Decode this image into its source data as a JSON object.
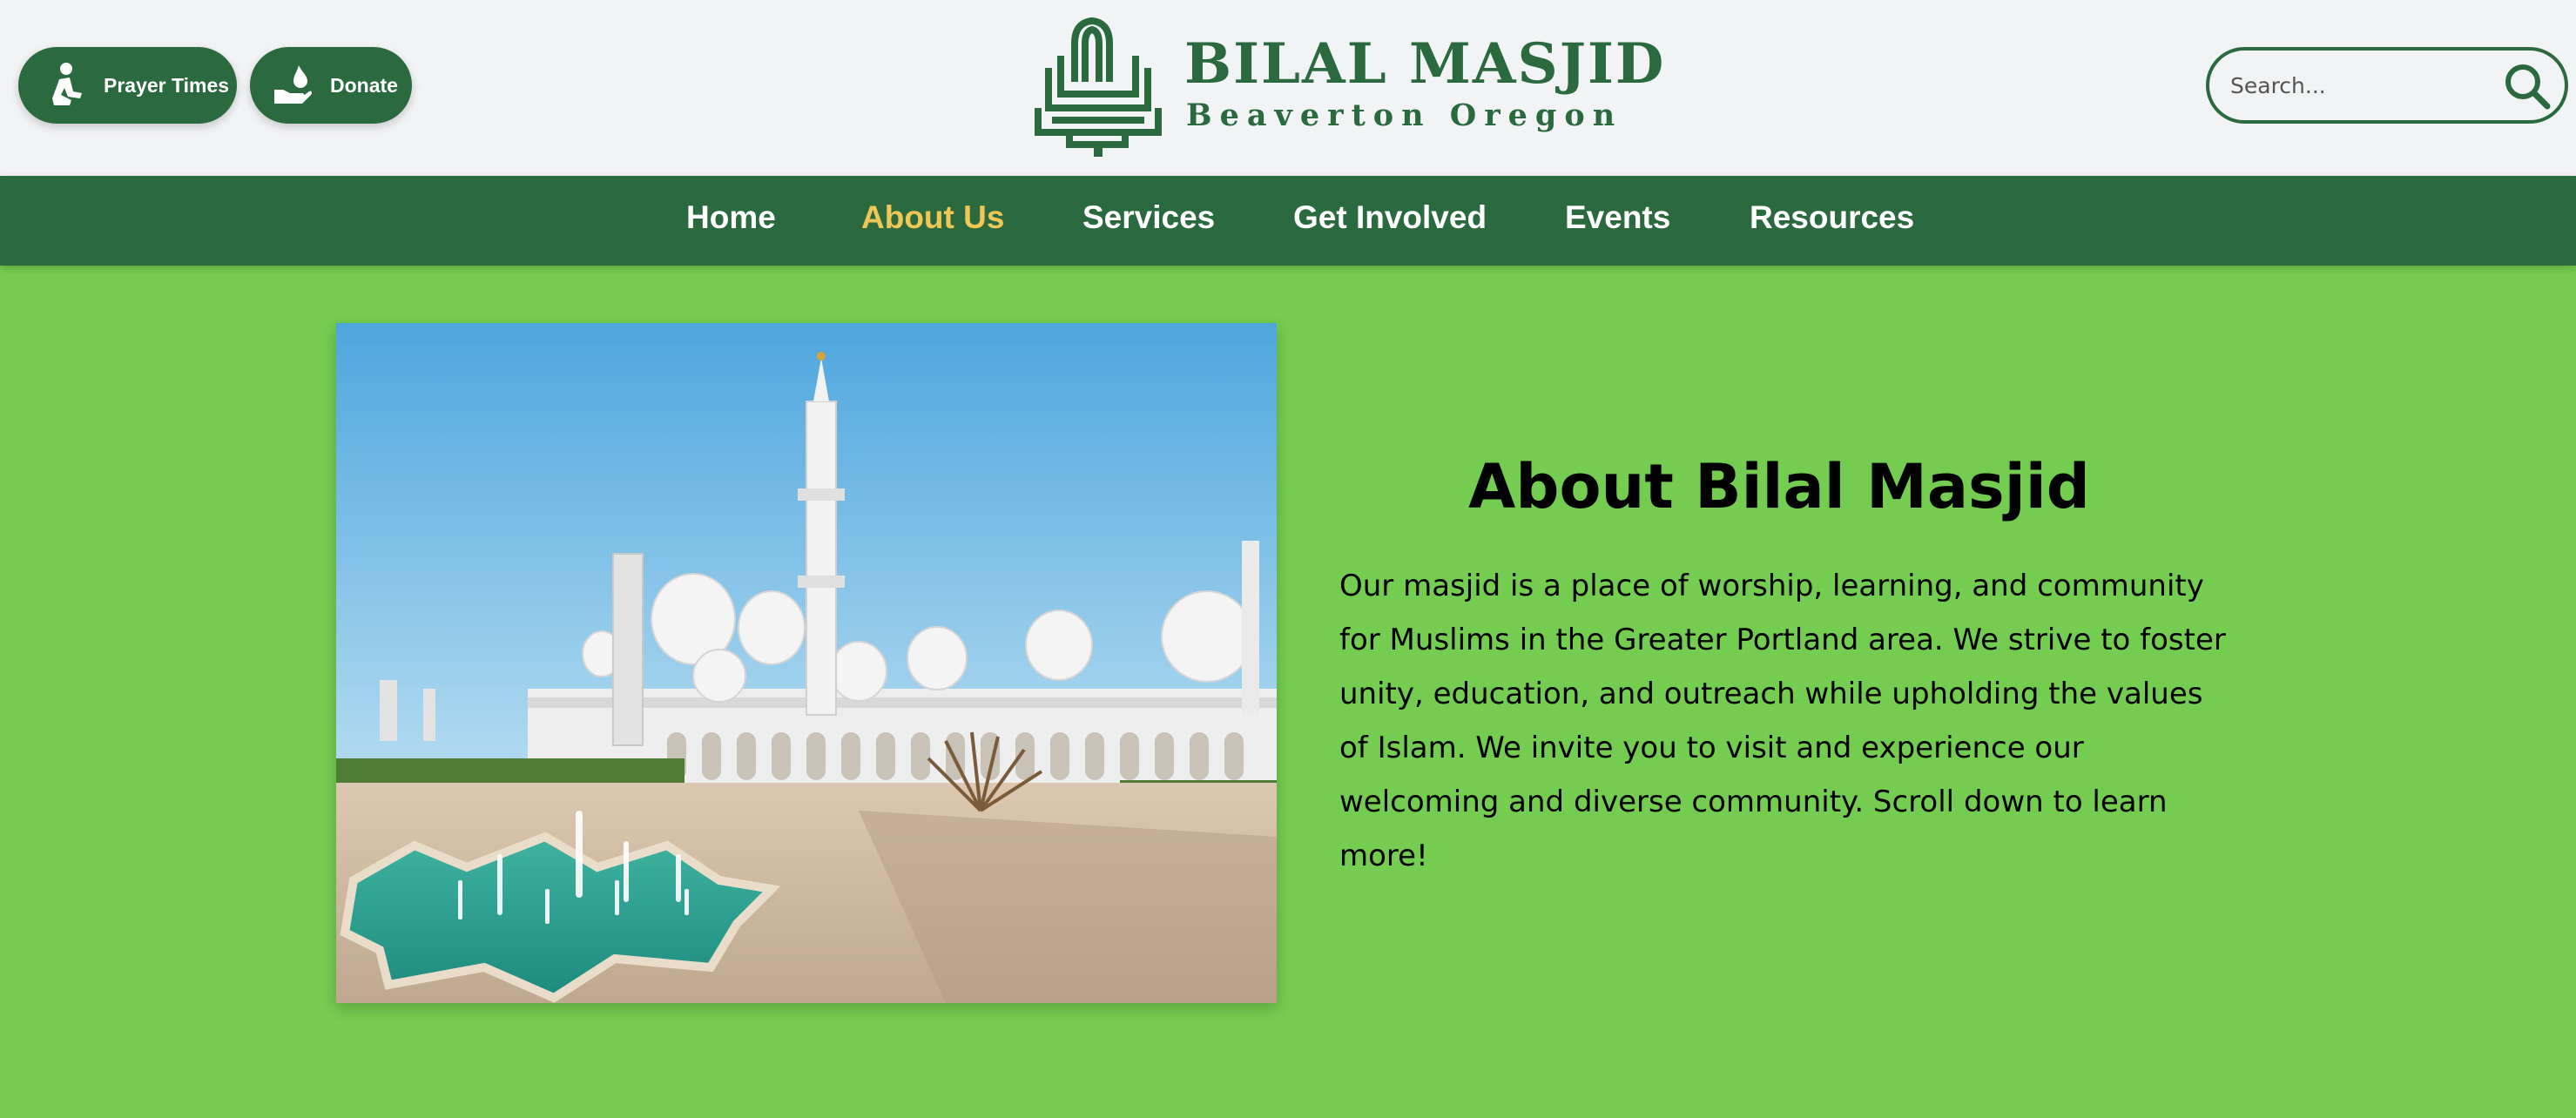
{
  "header": {
    "prayer_times_label": "Prayer Times",
    "donate_label": "Donate",
    "logo": {
      "title": "BILAL MASJID",
      "subtitle": "Beaverton Oregon"
    },
    "search": {
      "placeholder": "Search...",
      "value": ""
    }
  },
  "nav": {
    "items": [
      {
        "label": "Home",
        "active": false
      },
      {
        "label": "About Us",
        "active": true
      },
      {
        "label": "Services",
        "active": false
      },
      {
        "label": "Get Involved",
        "active": false
      },
      {
        "label": "Events",
        "active": false
      },
      {
        "label": "Resources",
        "active": false
      }
    ]
  },
  "main": {
    "about_title": "About Bilal Masjid",
    "about_text": "Our masjid is a place of worship, learning, and community for Muslims in the Greater Portland area. We strive to foster unity, education, and outreach while upholding the values of Islam. We invite you to visit and experience our welcoming and diverse community. Scroll down to learn more!"
  },
  "icons": {
    "prayer": "praying-person-icon",
    "donate": "hand-donation-icon",
    "search": "search-icon",
    "logo": "masjid-calligraphy-logo"
  },
  "colors": {
    "brand_green": "#2a6a3e",
    "page_background": "#74cc50",
    "header_background": "#f2f3f5",
    "nav_active": "#f0c755",
    "nav_text": "#ffffff"
  }
}
